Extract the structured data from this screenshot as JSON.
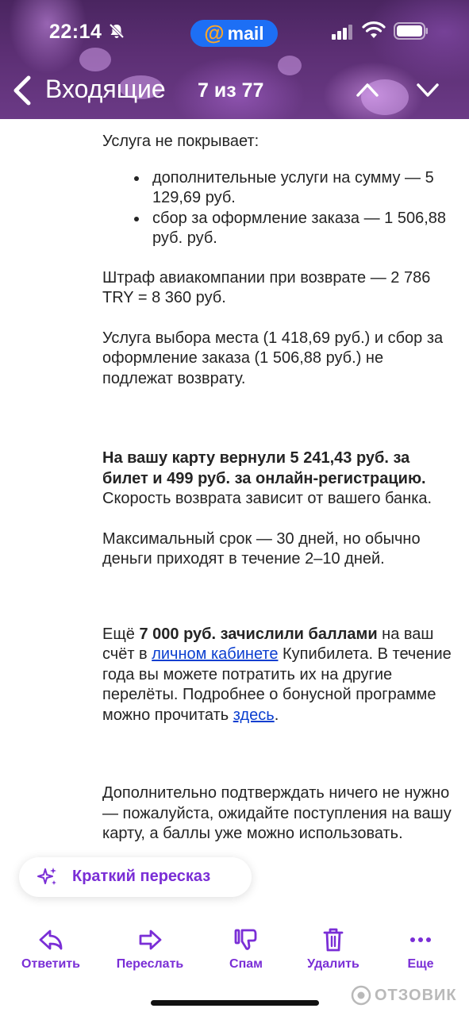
{
  "status_bar": {
    "time": "22:14",
    "app_badge": "mail",
    "app_badge_at": "@"
  },
  "nav": {
    "title": "Входящие",
    "counter": "7 из 77"
  },
  "body": {
    "not_covered_heading": "Услуга не покрывает:",
    "not_covered_items": [
      "дополнительные услуги на сумму — 5 129,69 руб.",
      "сбор за оформление заказа — 1 506,88 руб. руб."
    ],
    "airline_penalty": "Штраф авиакомпании при возврате — 2 786 TRY = 8 360 руб.",
    "non_refundable": "Услуга выбора места (1 418,69 руб.) и сбор за оформление заказа (1 506,88 руб.) не подлежат возврату.",
    "refund_bold": "На вашу карту вернули 5 241,43 руб. за билет и 499 руб. за онлайн-регистрацию.",
    "refund_rest": " Скорость возврата зависит от вашего банка.",
    "max_term": "Максимальный срок — 30 дней, но обычно деньги приходят в течение 2–10 дней.",
    "points_prefix": "Ещё ",
    "points_bold": "7 000 руб. зачислили баллами",
    "points_mid": " на ваш счёт в ",
    "points_link": "личном кабинете",
    "points_after_link": " Купибилета. В течение года вы можете потратить их на другие перелёты. Подробнее о бонусной программе можно прочитать ",
    "points_link2": "здесь",
    "points_end": ".",
    "final_note": "Дополнительно подтверждать ничего не нужно — пожалуйста, ожидайте поступления на вашу карту, а баллы уже можно использовать."
  },
  "summary_chip": {
    "label": "Краткий пересказ"
  },
  "toolbar": {
    "reply": "Ответить",
    "forward": "Переслать",
    "spam": "Спам",
    "delete": "Удалить",
    "more": "Еще"
  },
  "watermark": "ОТЗОВИК",
  "colors": {
    "accent": "#7a2ed6",
    "link": "#0b3fd0",
    "badge": "#1d6ff5"
  }
}
